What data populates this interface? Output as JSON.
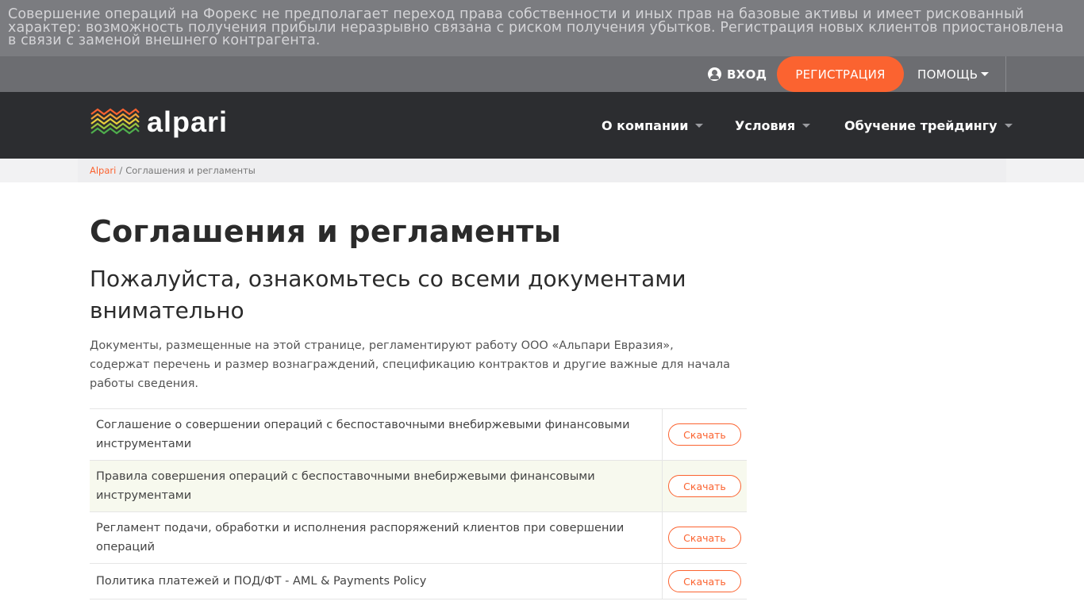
{
  "warning": {
    "text": "Совершение операций на Форекс не предполагает переход права собственности и иных прав на базовые активы и имеет рискованный характер: возможность получения прибыли неразрывно связана с риском получения убытков. Регистрация новых клиентов приостановлена в связи с заменой внешнего контрагента."
  },
  "user_bar": {
    "login_label": "ВХОД",
    "register_label": "РЕГИСТРАЦИЯ",
    "help_label": "ПОМОЩЬ"
  },
  "nav": {
    "logo_text": "alpari",
    "items": [
      {
        "label": "О компании"
      },
      {
        "label": "Условия"
      },
      {
        "label": "Обучение трейдингу"
      }
    ]
  },
  "breadcrumb": {
    "home": "Alpari",
    "separator": "/",
    "current": "Соглашения и регламенты"
  },
  "page": {
    "title": "Соглашения и регламенты",
    "subtitle": "Пожалуйста, ознакомьтесь со всеми документами внимательно",
    "intro": "Документы, размещенные на этой странице, регламентируют работу ООО «Альпари Евразия», содержат перечень и размер вознаграждений, спецификацию контрактов и другие важные для начала работы сведения."
  },
  "documents": [
    {
      "title": "Соглашение о совершении операций с беспоставочными внебиржевыми финансовыми инструментами",
      "action": "Скачать"
    },
    {
      "title": "Правила совершения операций с беспоставочными внебиржевыми финансовыми инструментами",
      "action": "Скачать"
    },
    {
      "title": "Регламент подачи, обработки и исполнения распоряжений клиентов при совершении операций",
      "action": "Скачать"
    },
    {
      "title": "Политика платежей и ПОД/ФТ - AML & Payments Policy",
      "action": "Скачать"
    }
  ],
  "colors": {
    "accent": "#fb6330",
    "warning_bg": "#7b7c80",
    "user_bar_bg": "#6c6d71",
    "nav_bg": "#2c2d30",
    "highlight_row": "#f7f9ee"
  },
  "icons": {
    "login": "user-circle-icon",
    "dropdown": "caret-down-icon",
    "logo": "alpari-waves-logo-icon"
  }
}
